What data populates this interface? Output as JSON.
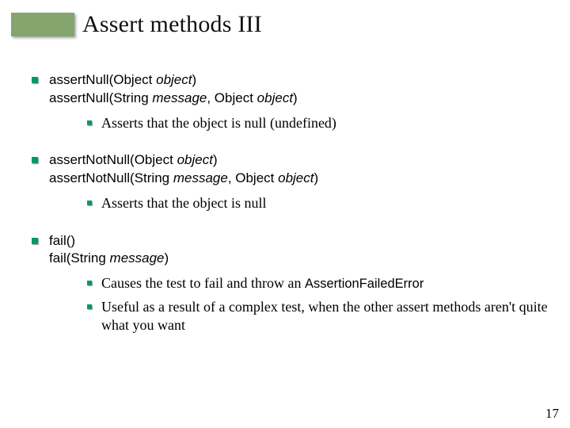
{
  "title": "Assert methods III",
  "pageNumber": "17",
  "items": [
    {
      "line1_a": "assertNull(Object ",
      "line1_b": "object",
      "line1_c": ")",
      "line2_a": "assertNull(String ",
      "line2_b": "message",
      "line2_c": ", Object ",
      "line2_d": "object",
      "line2_e": ")",
      "subs": [
        {
          "text": "Asserts that the object is null (undefined)"
        }
      ]
    },
    {
      "line1_a": "assertNotNull(Object ",
      "line1_b": "object",
      "line1_c": ")",
      "line2_a": "assertNotNull(String ",
      "line2_b": "message",
      "line2_c": ", Object ",
      "line2_d": "object",
      "line2_e": ")",
      "subs": [
        {
          "text": "Asserts that the object is null"
        }
      ]
    },
    {
      "line1_a": "fail()",
      "line1_b": "",
      "line1_c": "",
      "line2_a": "fail(String ",
      "line2_b": "message",
      "line2_c": ")",
      "line2_d": "",
      "line2_e": "",
      "subs": [
        {
          "text_a": "Causes the test to fail and throw an ",
          "sans": "AssertionFailedError"
        },
        {
          "text": "Useful as a result of a complex test, when the other assert methods aren't quite what you want"
        }
      ]
    }
  ]
}
